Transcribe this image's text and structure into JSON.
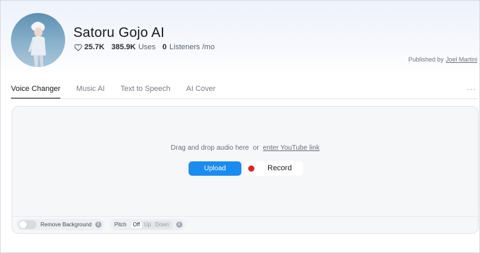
{
  "profile": {
    "name": "Satoru Gojo AI",
    "likes": "25.7K",
    "uses": "385.9K",
    "uses_label": "Uses",
    "listeners": "0",
    "listeners_label": "Listeners /mo",
    "published_label": "Published by",
    "author": "Joel Martini"
  },
  "tabs": [
    {
      "label": "Voice Changer",
      "active": true
    },
    {
      "label": "Music AI"
    },
    {
      "label": "Text to Speech"
    },
    {
      "label": "AI Cover"
    }
  ],
  "more_label": "···",
  "dropzone": {
    "text": "Drag and drop audio here",
    "or": "or",
    "youtube_link": "enter YouTube link"
  },
  "buttons": {
    "upload": "Upload",
    "record": "Record"
  },
  "options": {
    "remove_background_label": "Remove Background",
    "remove_background_on": false,
    "pitch_label": "Pitch",
    "pitch_options": [
      "Off",
      "Up",
      "Down"
    ],
    "pitch_selected": "Off",
    "info_glyph": "i"
  },
  "colors": {
    "accent": "#1a8cf0",
    "record_dot": "#e8201a"
  },
  "icons": {
    "likes": "heart-icon",
    "record": "record-dot-icon",
    "info": "info-icon",
    "more": "more-horizontal-icon"
  }
}
